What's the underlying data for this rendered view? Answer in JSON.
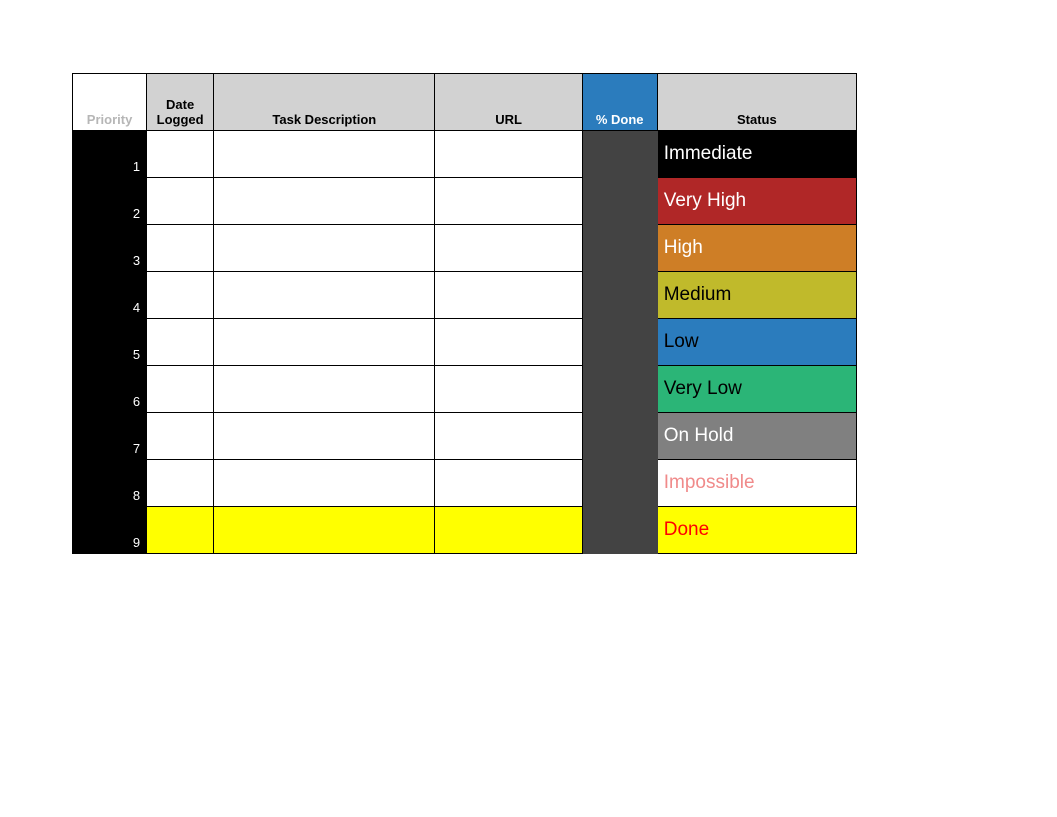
{
  "header": {
    "priority": "Priority",
    "date_logged": "Date Logged",
    "task_description": "Task Description",
    "url": "URL",
    "percent_done": "% Done",
    "status": "Status"
  },
  "rows": [
    {
      "priority": "1",
      "date_logged": "",
      "task_description": "",
      "url": "",
      "percent_done": "",
      "status": "Immediate",
      "status_class": "st-immediate",
      "row_bg": "white"
    },
    {
      "priority": "2",
      "date_logged": "",
      "task_description": "",
      "url": "",
      "percent_done": "",
      "status": "Very High",
      "status_class": "st-veryhigh",
      "row_bg": "white"
    },
    {
      "priority": "3",
      "date_logged": "",
      "task_description": "",
      "url": "",
      "percent_done": "",
      "status": "High",
      "status_class": "st-high",
      "row_bg": "white"
    },
    {
      "priority": "4",
      "date_logged": "",
      "task_description": "",
      "url": "",
      "percent_done": "",
      "status": "Medium",
      "status_class": "st-medium",
      "row_bg": "white"
    },
    {
      "priority": "5",
      "date_logged": "",
      "task_description": "",
      "url": "",
      "percent_done": "",
      "status": "Low",
      "status_class": "st-low",
      "row_bg": "white"
    },
    {
      "priority": "6",
      "date_logged": "",
      "task_description": "",
      "url": "",
      "percent_done": "",
      "status": "Very Low",
      "status_class": "st-verylow",
      "row_bg": "white"
    },
    {
      "priority": "7",
      "date_logged": "",
      "task_description": "",
      "url": "",
      "percent_done": "",
      "status": "On Hold",
      "status_class": "st-onhold",
      "row_bg": "white"
    },
    {
      "priority": "8",
      "date_logged": "",
      "task_description": "",
      "url": "",
      "percent_done": "",
      "status": "Impossible",
      "status_class": "st-impossible",
      "row_bg": "white"
    },
    {
      "priority": "9",
      "date_logged": "",
      "task_description": "",
      "url": "",
      "percent_done": "",
      "status": "Done",
      "status_class": "st-done",
      "row_bg": "yellow"
    }
  ]
}
